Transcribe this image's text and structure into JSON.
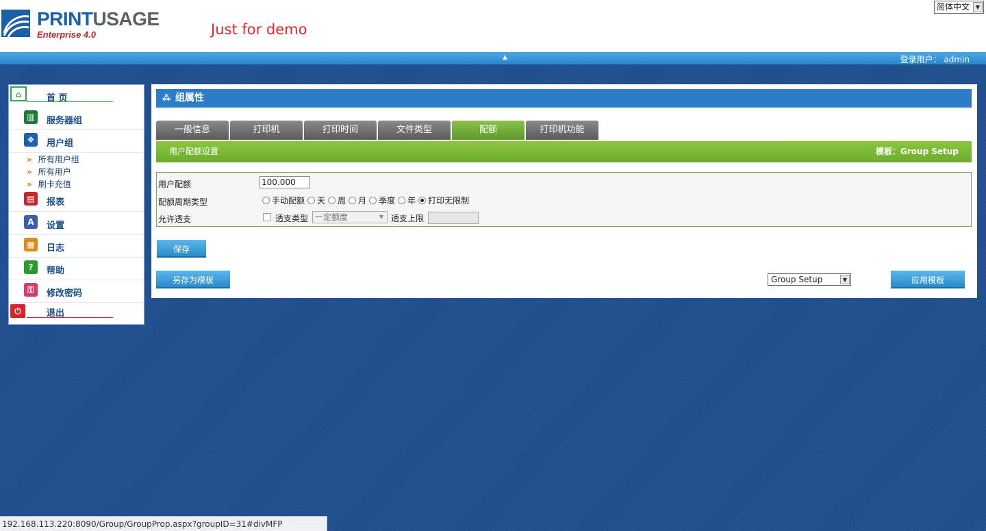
{
  "header": {
    "logo": {
      "print": "PRINT",
      "usage": "USAGE",
      "edition": "Enterprise 4.0"
    },
    "demo_text": "Just for demo",
    "language": "简体中文",
    "login_user": "登录用户： admin"
  },
  "sidebar": {
    "items": [
      {
        "label": "首 页",
        "icon": "home-icon"
      },
      {
        "label": "服务器组",
        "icon": "server-group-icon"
      },
      {
        "label": "用户组",
        "icon": "user-group-icon"
      },
      {
        "label": "报表",
        "icon": "report-icon"
      },
      {
        "label": "设置",
        "icon": "settings-icon"
      },
      {
        "label": "日志",
        "icon": "log-icon"
      },
      {
        "label": "帮助",
        "icon": "help-icon"
      },
      {
        "label": "修改密码",
        "icon": "key-icon"
      },
      {
        "label": "退出",
        "icon": "logout-icon"
      }
    ],
    "subitems": [
      "所有用户组",
      "所有用户",
      "刷卡充值"
    ]
  },
  "main": {
    "title": "组属性",
    "tabs": [
      "一般信息",
      "打印机",
      "打印时间",
      "文件类型",
      "配额",
      "打印机功能"
    ],
    "active_tab": "配额",
    "section_title": "用户配额设置",
    "template_label": "模板：Group Setup",
    "quota_label": "用户配额",
    "quota_value": "100.000",
    "period_label": "配额周期类型",
    "quota_period": {
      "options": [
        "手动配额",
        "天",
        "周",
        "月",
        "季度",
        "年",
        "打印无限制"
      ],
      "selected": "打印无限制"
    },
    "overdraft_label": "允许透支",
    "overdraft_checked": false,
    "overdraft_type_label": "透支类型",
    "overdraft_type_value": "一定额度",
    "overdraft_limit_label": "透支上限",
    "overdraft_limit_value": "",
    "save_button": "保存",
    "save_as_template_button": "另存为模板",
    "template_select_value": "Group Setup",
    "apply_template_button": "应用模板"
  },
  "status_bar": {
    "url": "192.168.113.220:8090/Group/GroupProp.aspx?groupID=31#divMFP"
  },
  "colors": {
    "brand_blue": "#1a5fa8",
    "title_bar": "#2b7dc8",
    "active_tab": "#7ab33c",
    "page_background": "#1f4e8e",
    "demo_text": "#e8262a"
  }
}
